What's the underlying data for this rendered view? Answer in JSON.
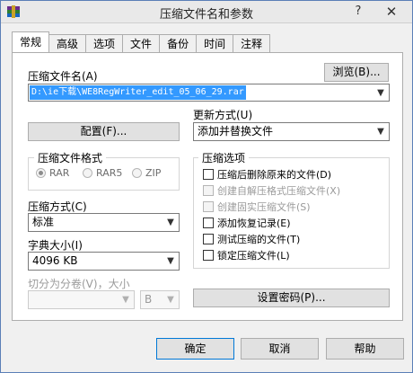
{
  "window": {
    "title": "压缩文件名和参数",
    "help_glyph": "?",
    "close_glyph": "✕"
  },
  "tabs": [
    {
      "label": "常规",
      "active": true
    },
    {
      "label": "高级"
    },
    {
      "label": "选项"
    },
    {
      "label": "文件"
    },
    {
      "label": "备份"
    },
    {
      "label": "时间"
    },
    {
      "label": "注释"
    }
  ],
  "general": {
    "archive_name_label": "压缩文件名(A)",
    "browse_label": "浏览(B)...",
    "archive_path": "D:\\ie下载\\WE8RegWriter_edit_05_06_29.rar",
    "profiles_label": "配置(F)...",
    "update_mode_label": "更新方式(U)",
    "update_mode_value": "添加并替换文件",
    "format_group_label": "压缩文件格式",
    "formats": [
      {
        "label": "RAR",
        "checked": true
      },
      {
        "label": "RAR5",
        "checked": false
      },
      {
        "label": "ZIP",
        "checked": false
      }
    ],
    "method_label": "压缩方式(C)",
    "method_value": "标准",
    "dict_label": "字典大小(I)",
    "dict_value": "4096 KB",
    "split_label": "切分为分卷(V)，大小",
    "split_value": "",
    "split_unit": "B",
    "options_group_label": "压缩选项",
    "options": [
      {
        "label": "压缩后删除原来的文件(D)",
        "checked": false,
        "enabled": true
      },
      {
        "label": "创建自解压格式压缩文件(X)",
        "checked": false,
        "enabled": false
      },
      {
        "label": "创建固实压缩文件(S)",
        "checked": false,
        "enabled": false
      },
      {
        "label": "添加恢复记录(E)",
        "checked": false,
        "enabled": true
      },
      {
        "label": "测试压缩的文件(T)",
        "checked": false,
        "enabled": true
      },
      {
        "label": "锁定压缩文件(L)",
        "checked": false,
        "enabled": true
      }
    ],
    "password_label": "设置密码(P)..."
  },
  "buttons": {
    "ok": "确定",
    "cancel": "取消",
    "help": "帮助"
  },
  "colors": {
    "accent": "#0078d7",
    "selection": "#3399ff"
  }
}
